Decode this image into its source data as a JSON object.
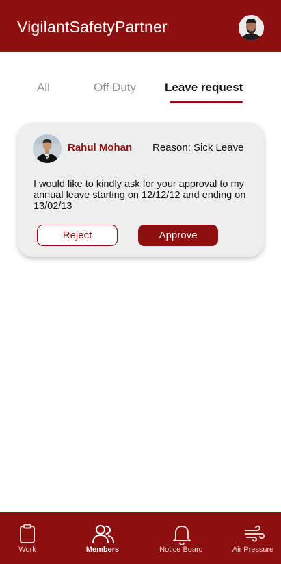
{
  "header": {
    "title": "VigilantSafetyPartner"
  },
  "tabs": [
    {
      "label": "All",
      "active": false
    },
    {
      "label": "Off Duty",
      "active": false
    },
    {
      "label": "Leave request",
      "active": true
    }
  ],
  "request": {
    "name": "Rahul Mohan",
    "reason": "Reason: Sick Leave",
    "message": "I would like to kindly ask for your approval to my  annual leave starting on 12/12/12 and ending on 13/02/13",
    "reject_label": "Reject",
    "approve_label": "Approve"
  },
  "bottom_nav": [
    {
      "label": "Work",
      "icon": "clipboard-icon",
      "active": false
    },
    {
      "label": "Members",
      "icon": "users-icon",
      "active": true
    },
    {
      "label": "Notice Board",
      "icon": "bell-icon",
      "active": false
    },
    {
      "label": "Air Pressure",
      "icon": "wind-icon",
      "active": false
    }
  ],
  "colors": {
    "brand": "#8e0f0f",
    "card_bg": "#eeeeee",
    "tab_inactive": "#8a8f98"
  }
}
